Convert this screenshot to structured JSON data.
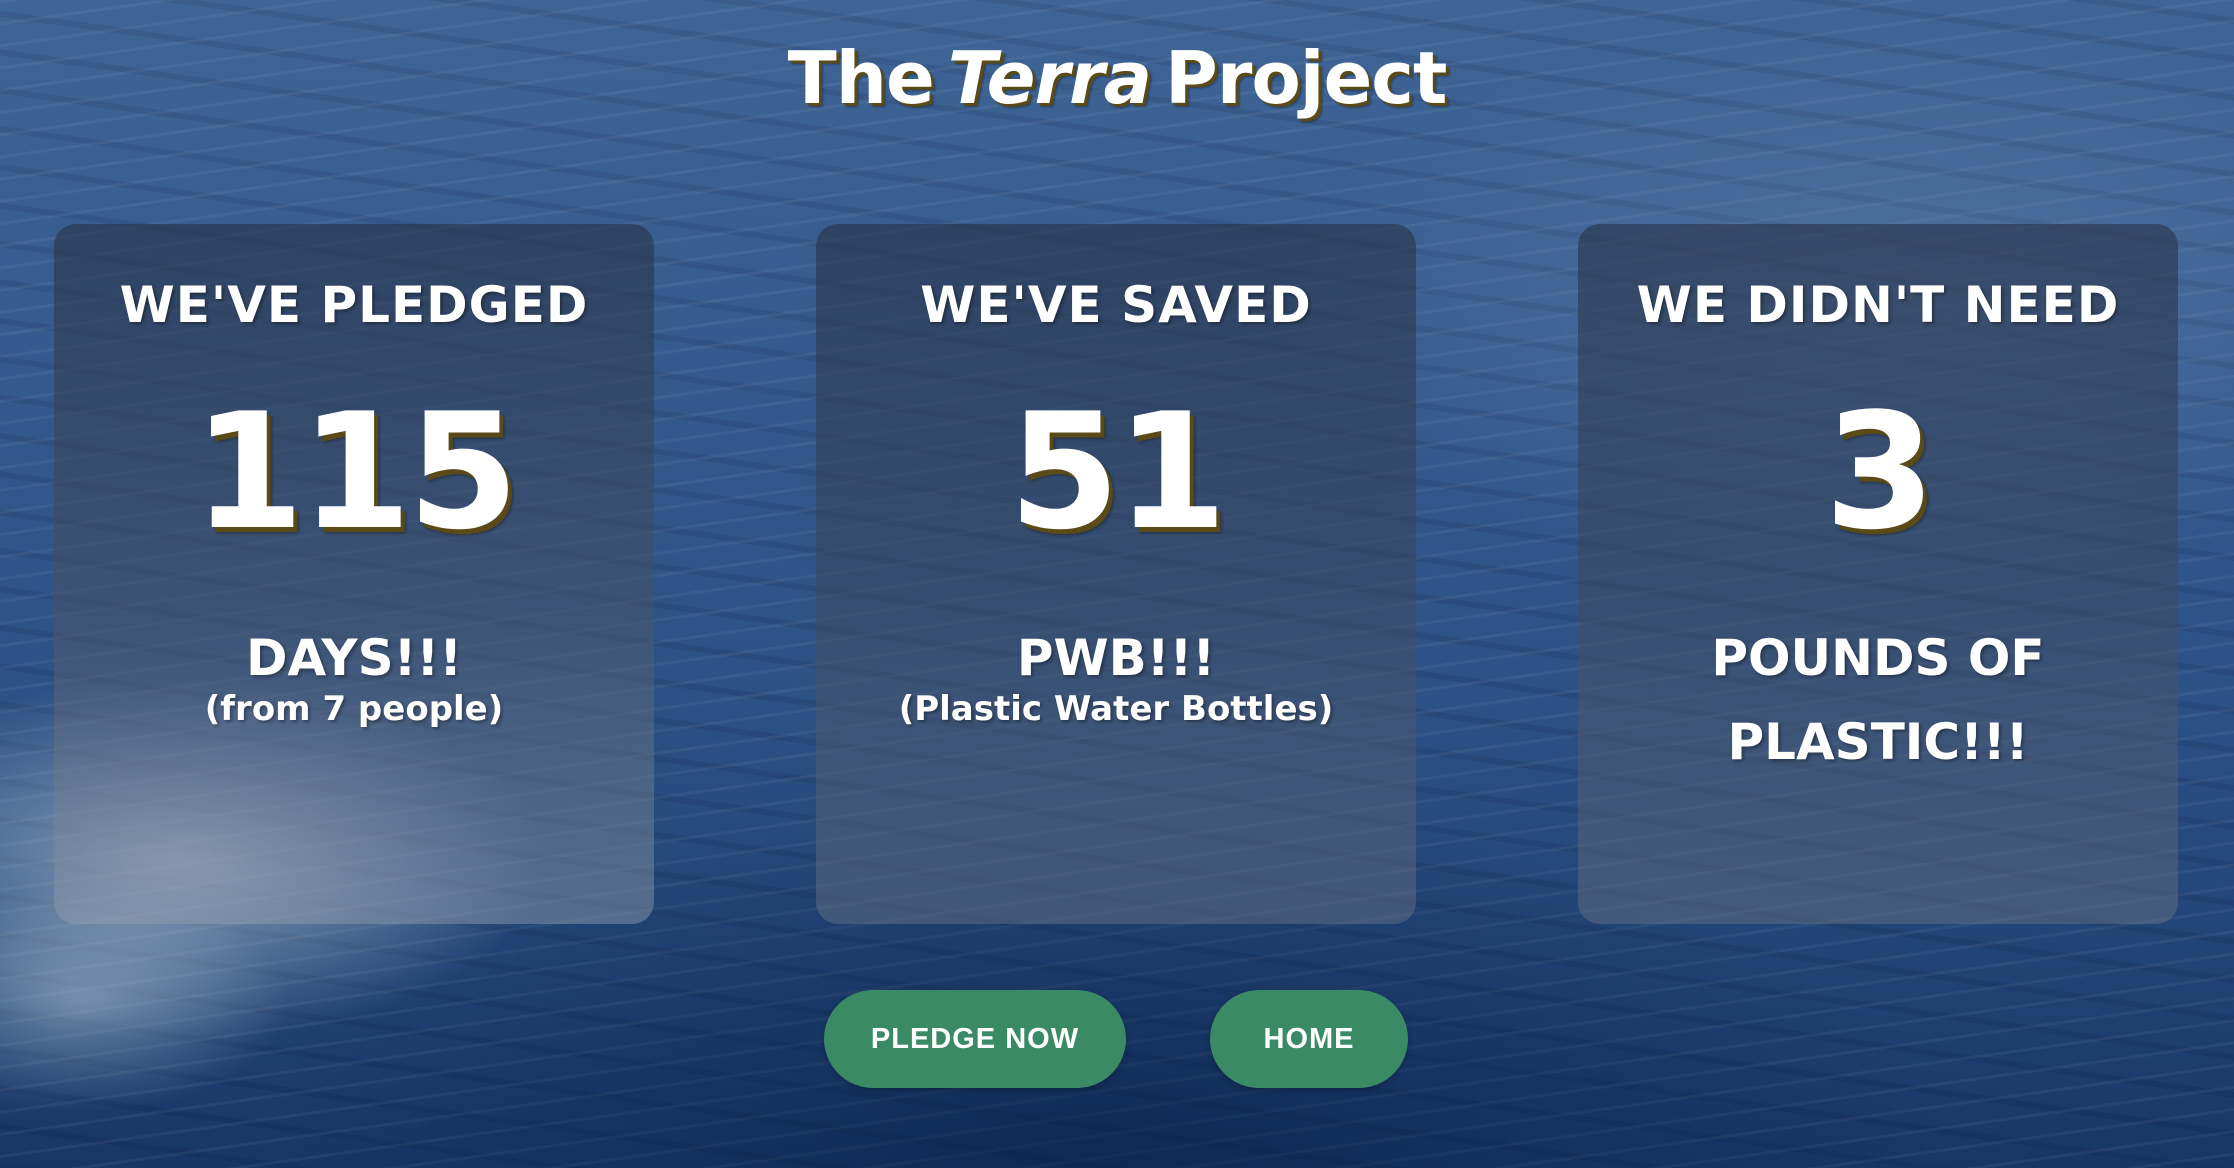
{
  "header": {
    "title_the": "The",
    "title_terra": "Terra",
    "title_project": "Project"
  },
  "cards": [
    {
      "heading": "WE'VE PLEDGED",
      "number": "115",
      "unit": "DAYS!!!",
      "note": "(from 7 people)"
    },
    {
      "heading": "WE'VE SAVED",
      "number": "51",
      "unit": "PWB!!!",
      "note": "(Plastic Water Bottles)"
    },
    {
      "heading": "WE DIDN'T NEED",
      "number": "3",
      "unit": "POUNDS OF PLASTIC!!!",
      "note": ""
    }
  ],
  "buttons": {
    "pledge_label": "PLEDGE NOW",
    "home_label": "HOME"
  },
  "colors": {
    "button_green": "#3a8a66",
    "text_white": "#ffffff",
    "shadow_olive": "#5a4a18"
  }
}
